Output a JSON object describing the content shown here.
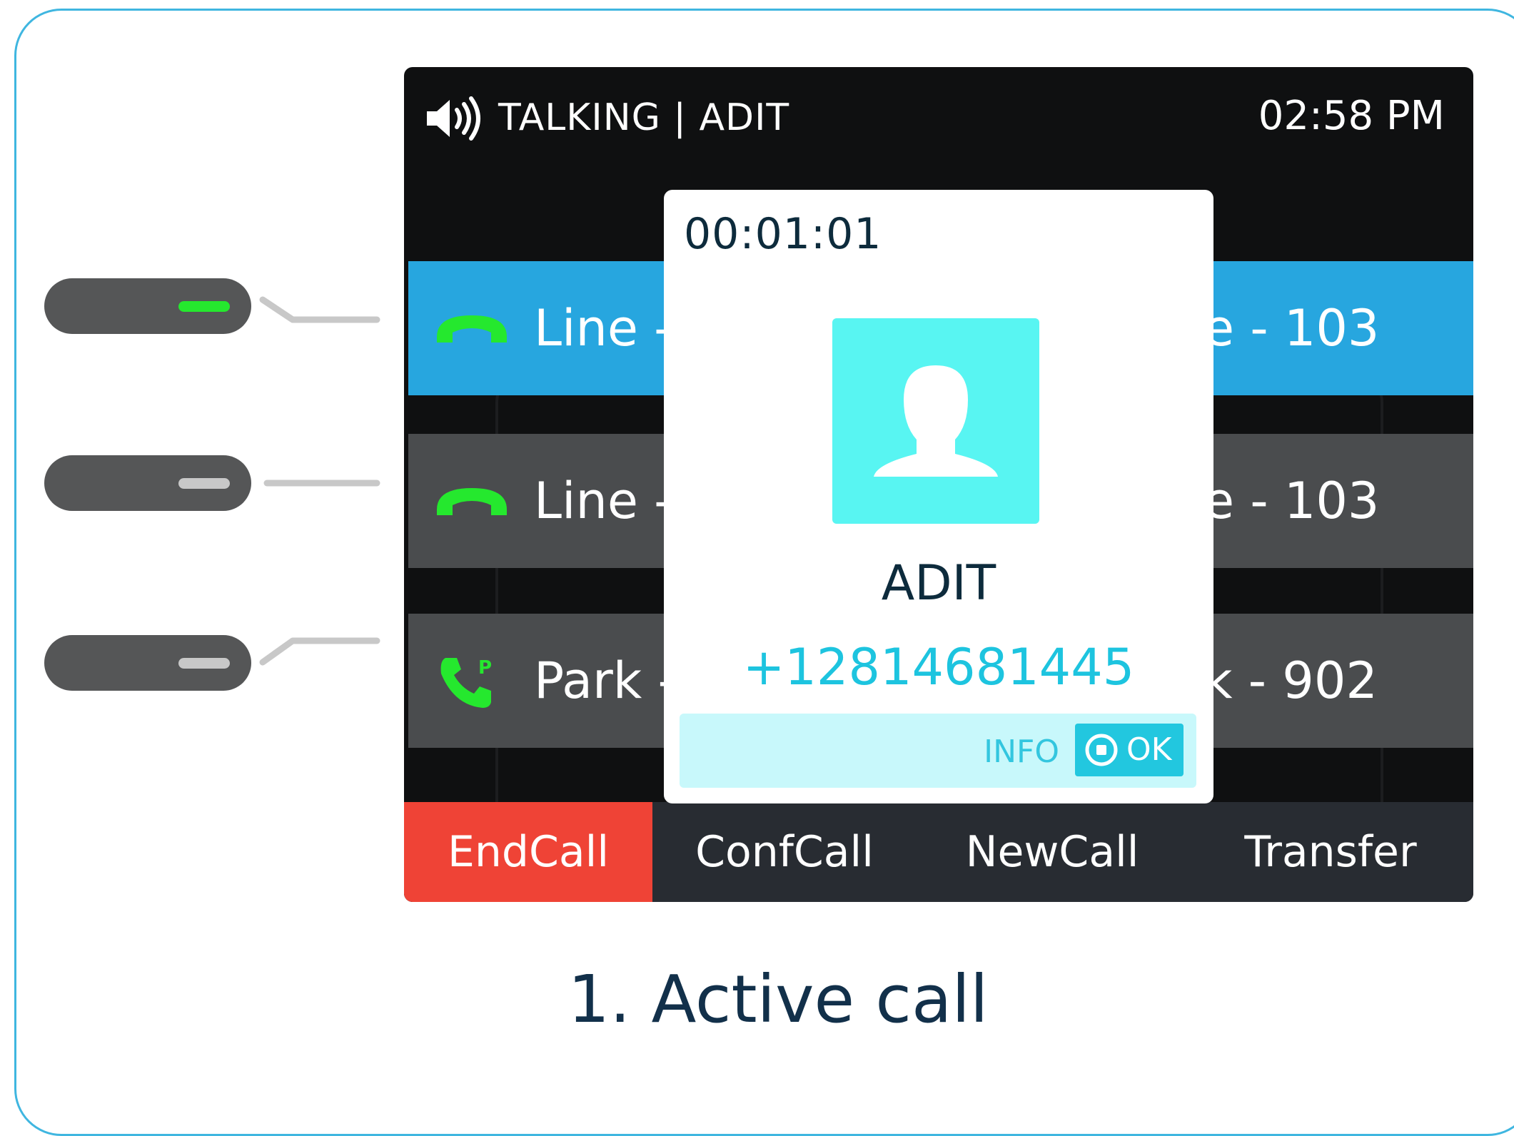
{
  "status": {
    "speaker_icon": "speaker-icon",
    "title": "TALKING | ADIT",
    "time": "02:58 PM"
  },
  "lines": [
    {
      "icon": "phone-handset-icon",
      "left_label": "Line -",
      "right_label": "e - 103",
      "active": true,
      "led_color": "#25e82e"
    },
    {
      "icon": "phone-handset-icon",
      "left_label": "Line -",
      "right_label": "e - 103",
      "active": false,
      "led_color": "#c8c8c8"
    },
    {
      "icon": "park-phone-icon",
      "left_label": "Park -",
      "right_label": "k - 902",
      "active": false,
      "led_color": "#c8c8c8"
    }
  ],
  "popup": {
    "timer": "00:01:01",
    "avatar_icon": "person-avatar-icon",
    "caller_name": "ADIT",
    "caller_number": "+12814681445",
    "info_label": "INFO",
    "ok_label": "OK"
  },
  "softkeys": [
    "EndCall",
    "ConfCall",
    "NewCall",
    "Transfer"
  ],
  "caption": "1. Active call",
  "colors": {
    "accent_blue": "#27a6df",
    "end_call_red": "#ef4336",
    "call_green": "#25e82e",
    "avatar_cyan": "#58f5f2",
    "number_cyan": "#1dc4df",
    "border_blue": "#3fb6e0"
  }
}
